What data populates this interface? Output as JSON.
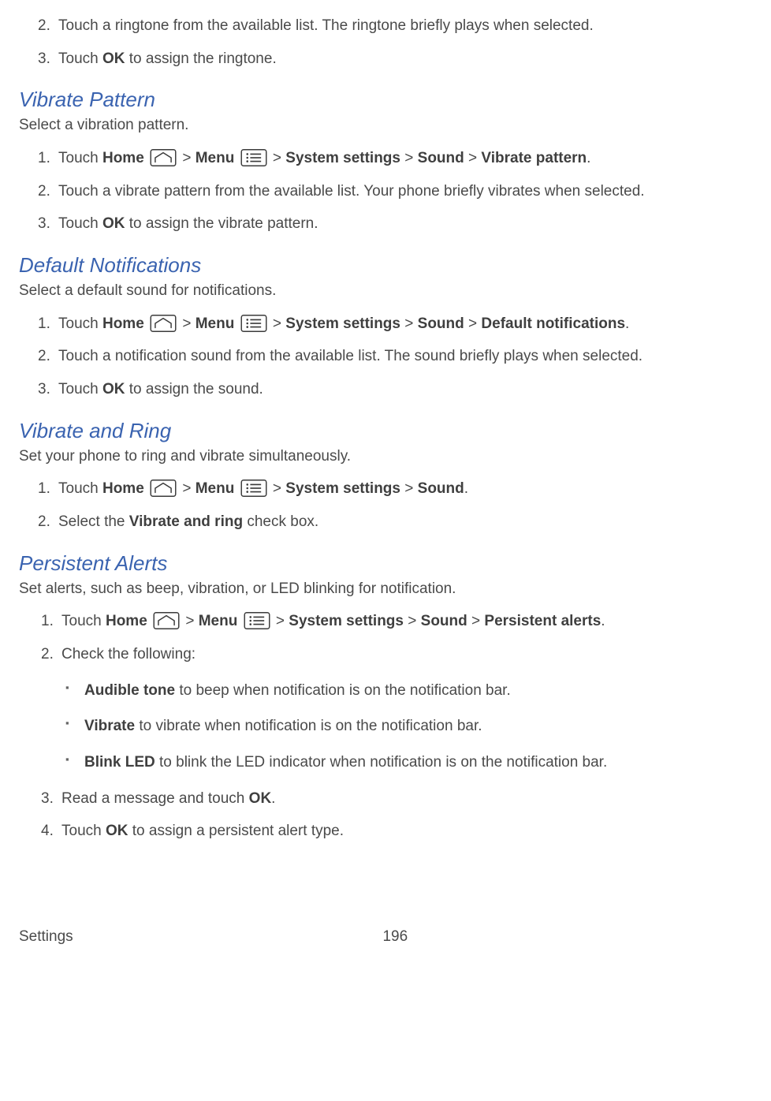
{
  "pre_list": [
    {
      "n": "2.",
      "parts": [
        {
          "t": "Touch a ringtone from the available list. The ringtone briefly plays when selected."
        }
      ]
    },
    {
      "n": "3.",
      "parts": [
        {
          "t": "Touch "
        },
        {
          "b": "OK"
        },
        {
          "t": " to assign the ringtone."
        }
      ]
    }
  ],
  "sections": [
    {
      "heading": "Vibrate Pattern",
      "intro": "Select a vibration pattern.",
      "list": [
        {
          "n": "1.",
          "parts": [
            {
              "t": "Touch "
            },
            {
              "b": "Home"
            },
            {
              "t": " "
            },
            {
              "icon": "home"
            },
            {
              "t": " > "
            },
            {
              "b": "Menu"
            },
            {
              "t": " "
            },
            {
              "icon": "menu"
            },
            {
              "t": " > "
            },
            {
              "b": "System settings"
            },
            {
              "t": " > "
            },
            {
              "b": "Sound"
            },
            {
              "t": " > "
            },
            {
              "b": "Vibrate pattern"
            },
            {
              "t": "."
            }
          ]
        },
        {
          "n": "2.",
          "parts": [
            {
              "t": "Touch a vibrate pattern from the available list. Your phone briefly vibrates when selected."
            }
          ]
        },
        {
          "n": "3.",
          "parts": [
            {
              "t": "Touch "
            },
            {
              "b": "OK"
            },
            {
              "t": " to assign the vibrate pattern."
            }
          ]
        }
      ]
    },
    {
      "heading": "Default Notifications",
      "intro": "Select a default sound for notifications.",
      "list": [
        {
          "n": "1.",
          "parts": [
            {
              "t": "Touch "
            },
            {
              "b": "Home"
            },
            {
              "t": " "
            },
            {
              "icon": "home"
            },
            {
              "t": " > "
            },
            {
              "b": "Menu"
            },
            {
              "t": " "
            },
            {
              "icon": "menu"
            },
            {
              "t": " > "
            },
            {
              "b": "System settings"
            },
            {
              "t": " > "
            },
            {
              "b": "Sound"
            },
            {
              "t": " > "
            },
            {
              "b": "Default notifications"
            },
            {
              "t": "."
            }
          ]
        },
        {
          "n": "2.",
          "parts": [
            {
              "t": "Touch a notification sound from the available list. The sound briefly plays when selected."
            }
          ]
        },
        {
          "n": "3.",
          "parts": [
            {
              "t": "Touch "
            },
            {
              "b": "OK"
            },
            {
              "t": " to assign the sound."
            }
          ]
        }
      ]
    },
    {
      "heading": "Vibrate and Ring",
      "intro": "Set your phone to ring and vibrate simultaneously.",
      "list": [
        {
          "n": "1.",
          "parts": [
            {
              "t": "Touch "
            },
            {
              "b": "Home"
            },
            {
              "t": " "
            },
            {
              "icon": "home"
            },
            {
              "t": " > "
            },
            {
              "b": "Menu"
            },
            {
              "t": " "
            },
            {
              "icon": "menu"
            },
            {
              "t": " > "
            },
            {
              "b": "System settings"
            },
            {
              "t": " > "
            },
            {
              "b": "Sound"
            },
            {
              "t": "."
            }
          ]
        },
        {
          "n": "2.",
          "parts": [
            {
              "t": "Select the "
            },
            {
              "b": "Vibrate and ring"
            },
            {
              "t": " check box."
            }
          ]
        }
      ]
    },
    {
      "heading": "Persistent Alerts",
      "intro": "Set alerts, such as beep, vibration, or LED blinking for notification.",
      "list": [
        {
          "n": "1.",
          "parts": [
            {
              "t": "Touch "
            },
            {
              "b": "Home"
            },
            {
              "t": " "
            },
            {
              "icon": "home"
            },
            {
              "t": " > "
            },
            {
              "b": "Menu"
            },
            {
              "t": " "
            },
            {
              "icon": "menu"
            },
            {
              "t": " > "
            },
            {
              "b": "System settings"
            },
            {
              "t": " > "
            },
            {
              "b": "Sound"
            },
            {
              "t": " > "
            },
            {
              "b": "Persistent alerts"
            },
            {
              "t": "."
            }
          ]
        },
        {
          "n": "2.",
          "parts": [
            {
              "t": "Check the following:"
            }
          ],
          "sub": [
            {
              "parts": [
                {
                  "b": "Audible tone"
                },
                {
                  "t": " to beep when notification is on the notification bar."
                }
              ]
            },
            {
              "parts": [
                {
                  "b": "Vibrate"
                },
                {
                  "t": " to vibrate when notification is on the notification bar."
                }
              ]
            },
            {
              "parts": [
                {
                  "b": "Blink LED"
                },
                {
                  "t": " to blink the LED indicator when notification is on the notification bar."
                }
              ]
            }
          ]
        },
        {
          "n": "3.",
          "parts": [
            {
              "t": "Read a message and touch "
            },
            {
              "b": "OK"
            },
            {
              "t": "."
            }
          ]
        },
        {
          "n": "4.",
          "parts": [
            {
              "t": "Touch "
            },
            {
              "b": "OK"
            },
            {
              "t": " to assign a persistent alert type."
            }
          ]
        }
      ]
    }
  ],
  "footer": {
    "left": "Settings",
    "page": "196"
  },
  "icons": {
    "home": "home-icon",
    "menu": "menu-icon"
  }
}
